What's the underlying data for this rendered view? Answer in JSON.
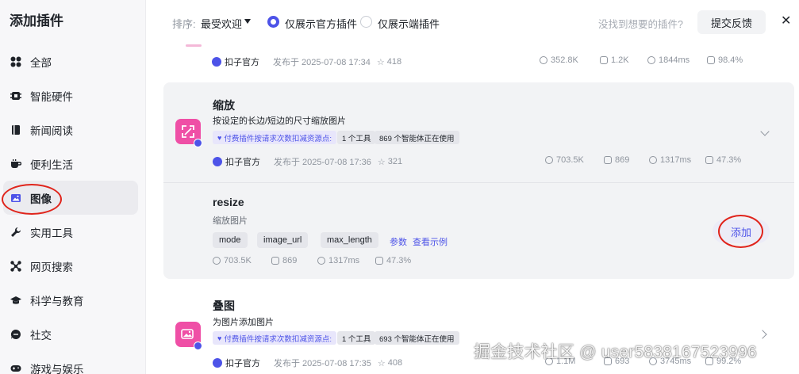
{
  "sidebar": {
    "title": "添加插件",
    "items": [
      {
        "label": "全部",
        "icon": "grid-icon"
      },
      {
        "label": "智能硬件",
        "icon": "chip-icon"
      },
      {
        "label": "新闻阅读",
        "icon": "book-icon"
      },
      {
        "label": "便利生活",
        "icon": "cup-icon"
      },
      {
        "label": "图像",
        "icon": "image-icon",
        "active": true
      },
      {
        "label": "实用工具",
        "icon": "wrench-icon"
      },
      {
        "label": "网页搜索",
        "icon": "network-icon"
      },
      {
        "label": "科学与教育",
        "icon": "graduation-icon"
      },
      {
        "label": "社交",
        "icon": "chat-icon"
      },
      {
        "label": "游戏与娱乐",
        "icon": "gamepad-icon"
      }
    ]
  },
  "toolbar": {
    "sort_label": "排序:",
    "sort_value": "最受欢迎",
    "filter_official": "仅展示官方插件",
    "filter_device": "仅展示端插件",
    "hint": "没找到想要的插件?",
    "feedback_label": "提交反馈"
  },
  "top_partial": {
    "publisher": "扣子官方",
    "published": "发布于 2025-07-08 17:34",
    "favorites": "418",
    "stat_calls": "352.8K",
    "stat_bots": "1.2K",
    "stat_latency": "1844ms",
    "stat_success": "98.4%"
  },
  "plugin_resize": {
    "title": "缩放",
    "desc": "按设定的长边/短边的尺寸缩放图片",
    "pay_tag": "付费插件按请求次数扣减资源点:",
    "tool_count": "1 个工具",
    "agents": "869 个智能体正在使用",
    "publisher": "扣子官方",
    "published": "发布于 2025-07-08 17:36",
    "favorites": "321",
    "stat_calls": "703.5K",
    "stat_bots": "869",
    "stat_latency": "1317ms",
    "stat_success": "47.3%",
    "tool": {
      "name": "resize",
      "desc": "缩放图片",
      "params": [
        "mode",
        "image_url",
        "max_length"
      ],
      "params_link": "参数",
      "example_link": "查看示例",
      "stat_calls": "703.5K",
      "stat_bots": "869",
      "stat_latency": "1317ms",
      "stat_success": "47.3%",
      "add_label": "添加"
    }
  },
  "plugin_overlay": {
    "title": "叠图",
    "desc": "为图片添加图片",
    "pay_tag": "付费插件按请求次数扣减资源点:",
    "tool_count": "1 个工具",
    "agents": "693 个智能体正在使用",
    "publisher": "扣子官方",
    "published": "发布于 2025-07-08 17:35",
    "favorites": "408",
    "stat_calls": "1.1M",
    "stat_bots": "693",
    "stat_latency": "3745ms",
    "stat_success": "99.2%"
  },
  "watermark": "掘金技术社区 @ user5838167523996",
  "colors": {
    "accent": "#4d53e8",
    "plugin_pink": "#ef4fa6",
    "highlight_red": "#e0241b"
  }
}
